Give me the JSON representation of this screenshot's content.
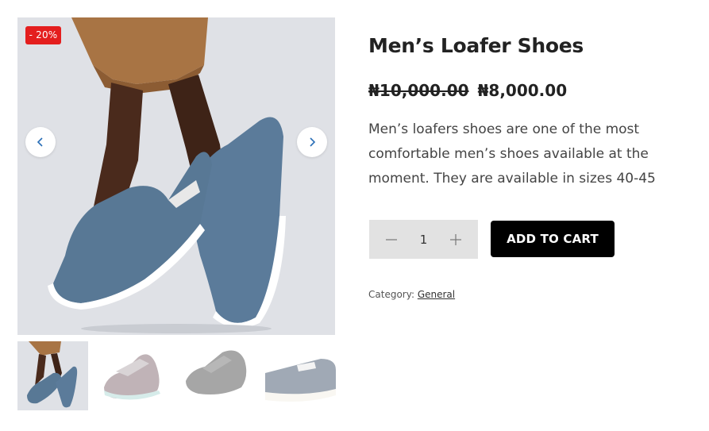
{
  "gallery": {
    "sale_badge": "- 20%",
    "main_image_alt": "Men's loafer shoes worn on feet",
    "prev_icon": "chevron-left-icon",
    "next_icon": "chevron-right-icon",
    "thumbnails": [
      {
        "alt": "Loafers worn on feet",
        "active": true
      },
      {
        "alt": "Grey loafer pair",
        "active": false
      },
      {
        "alt": "Dark grey loafer pair",
        "active": false
      },
      {
        "alt": "Blue loafer side view",
        "active": false
      }
    ]
  },
  "product": {
    "title": "Men’s Loafer Shoes",
    "regular_price": "₦10,000.00",
    "sale_price": "₦8,000.00",
    "description": "Men’s loafers shoes are one of the most comfortable men’s shoes available at the moment. They are available in sizes 40-45",
    "quantity": "1",
    "minus_icon": "minus-icon",
    "plus_icon": "plus-icon",
    "add_to_cart_label": "ADD TO CART",
    "category_label": "Category:",
    "category_link": "General"
  },
  "colors": {
    "badge": "#e41e1e",
    "button": "#000000",
    "shoe_blue": "#5b7b9a",
    "qty_bg": "#e2e2e2"
  }
}
